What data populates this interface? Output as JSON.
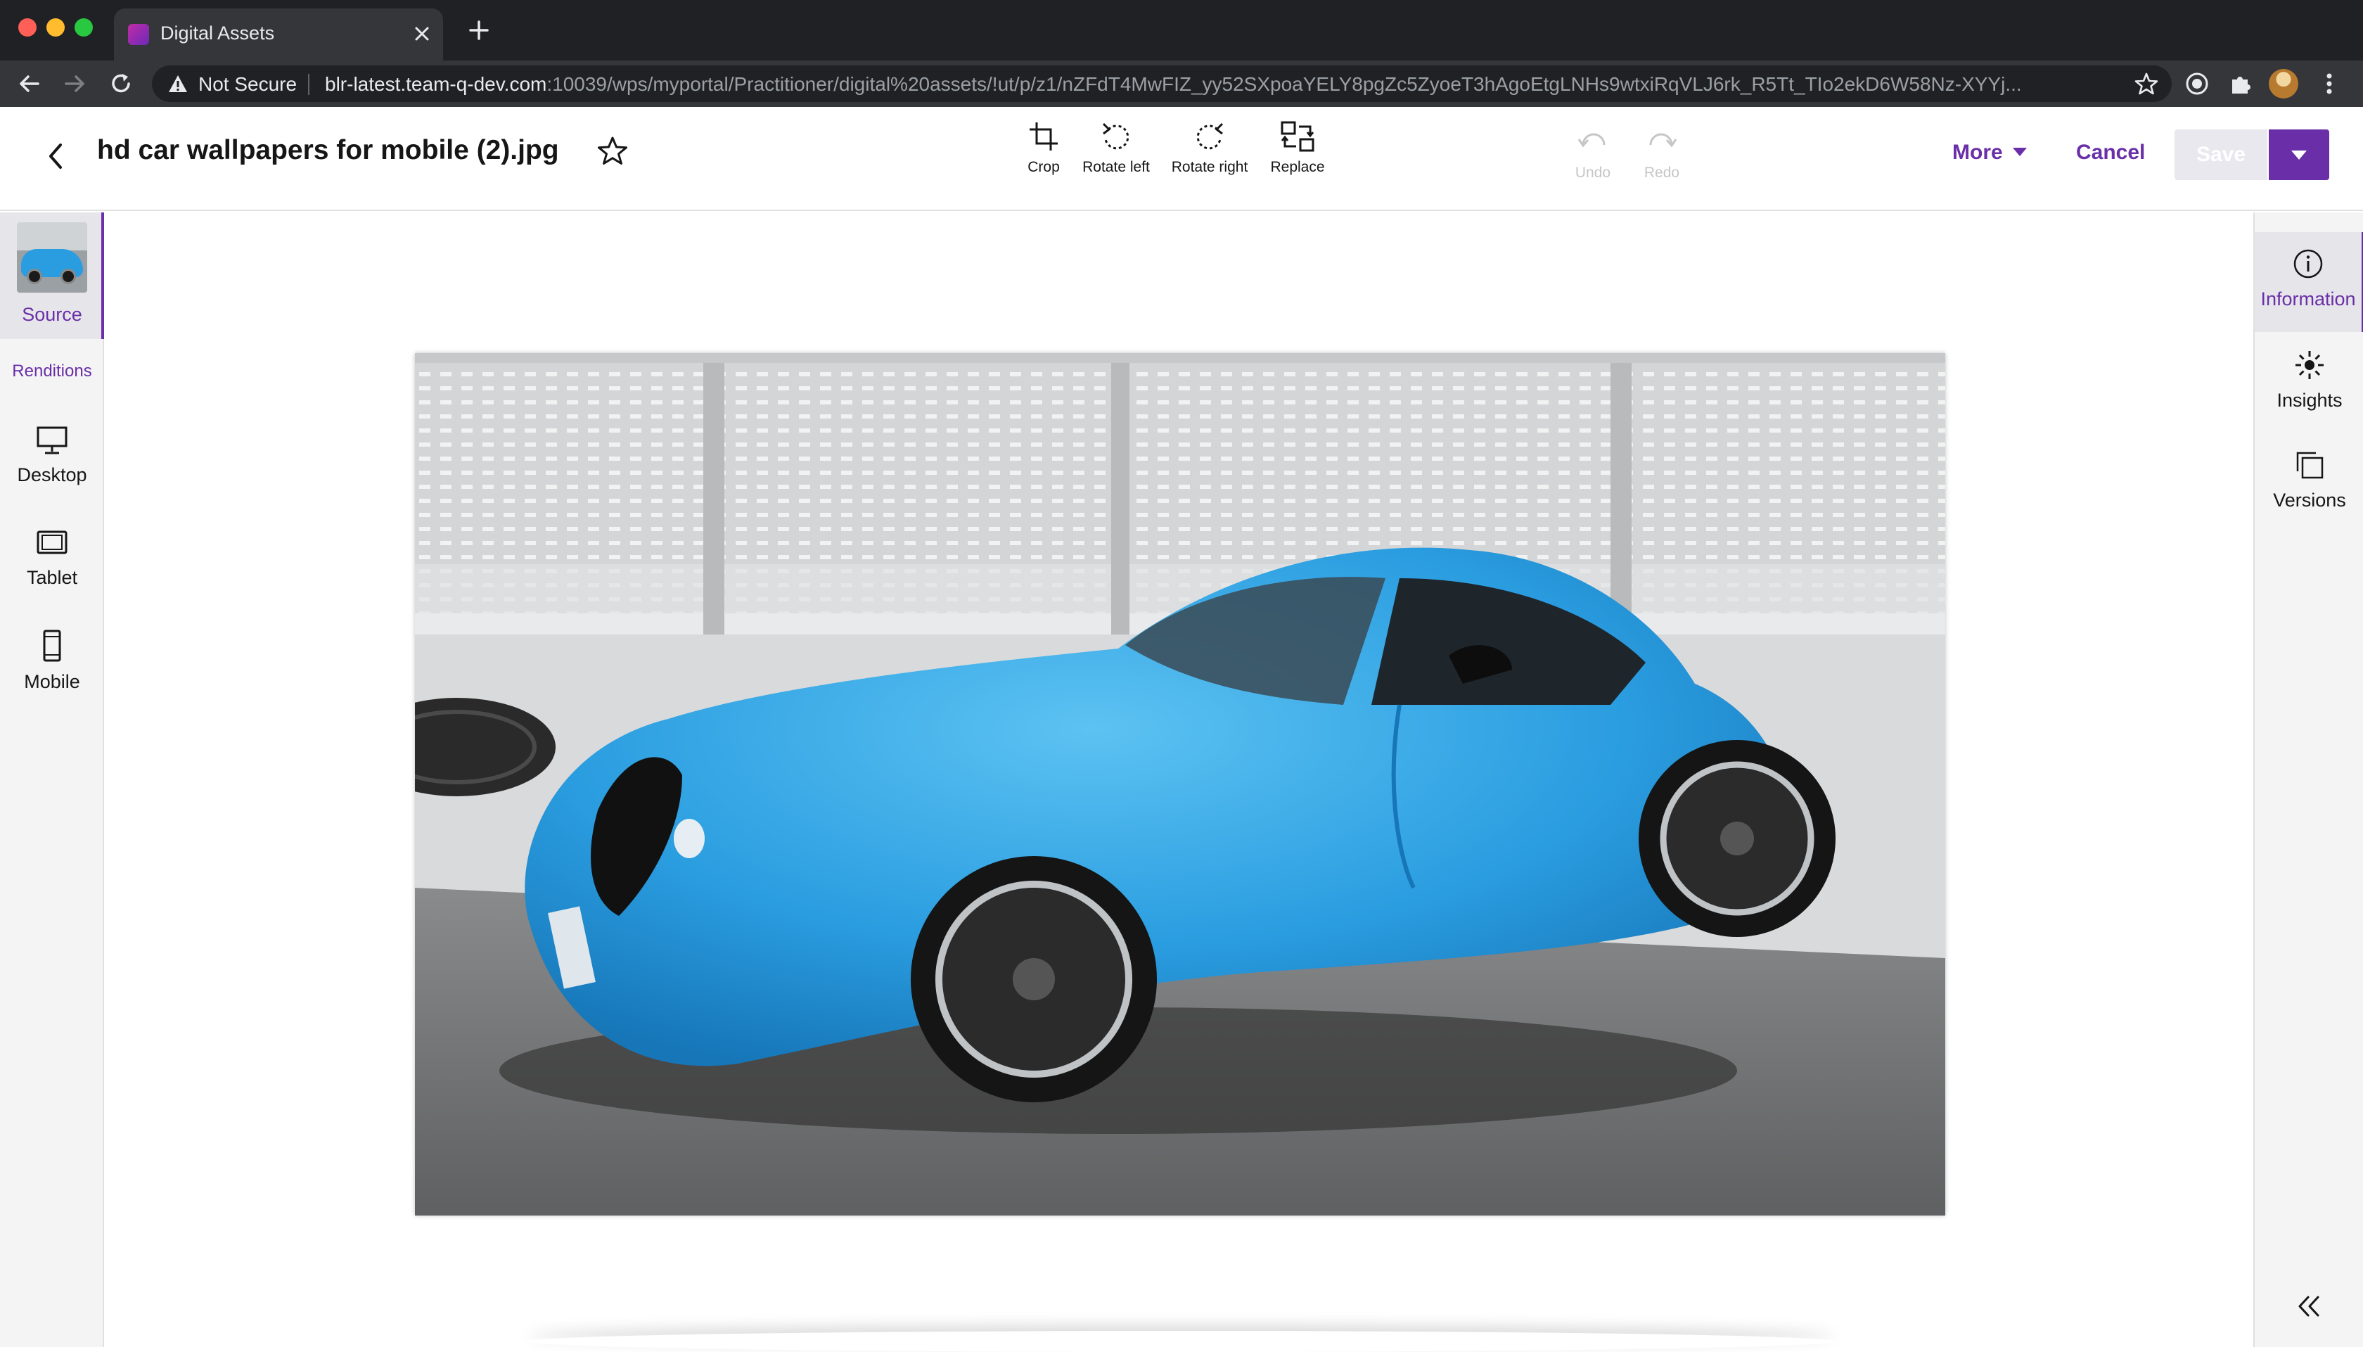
{
  "browser": {
    "tab_title": "Digital Assets",
    "address": {
      "security_label": "Not Secure",
      "url_host": "blr-latest.team-q-dev.com",
      "url_path": ":10039/wps/myportal/Practitioner/digital%20assets/!ut/p/z1/nZFdT4MwFIZ_yy52SXpoaYELY8pgZc5ZyoeT3hAgoEtgLNHs9wtxiRqVLJ6rk_R5Tt_TIo2ekD6W58Nz-XYYj..."
    }
  },
  "header": {
    "file_title": "hd car wallpapers for mobile (2).jpg",
    "tools": [
      {
        "label": "Crop",
        "icon": "crop-icon"
      },
      {
        "label": "Rotate left",
        "icon": "rotate-left-icon"
      },
      {
        "label": "Rotate right",
        "icon": "rotate-right-icon"
      },
      {
        "label": "Replace",
        "icon": "replace-icon"
      }
    ],
    "history": [
      {
        "label": "Undo",
        "icon": "undo-icon",
        "enabled": false
      },
      {
        "label": "Redo",
        "icon": "redo-icon",
        "enabled": false
      }
    ],
    "more_label": "More",
    "cancel_label": "Cancel",
    "save_label": "Save",
    "save_enabled": false
  },
  "left_rail": {
    "source_label": "Source",
    "renditions_label": "Renditions",
    "renditions": [
      {
        "label": "Desktop",
        "icon": "desktop-icon"
      },
      {
        "label": "Tablet",
        "icon": "tablet-icon"
      },
      {
        "label": "Mobile",
        "icon": "mobile-icon"
      }
    ]
  },
  "right_rail": {
    "items": [
      {
        "label": "Information",
        "icon": "info-icon",
        "active": true
      },
      {
        "label": "Insights",
        "icon": "insights-icon",
        "active": false
      },
      {
        "label": "Versions",
        "icon": "versions-icon",
        "active": false
      }
    ]
  },
  "colors": {
    "accent": "#6a2fa8",
    "chrome_dark": "#202124",
    "rail_bg": "#f4f4f4"
  }
}
